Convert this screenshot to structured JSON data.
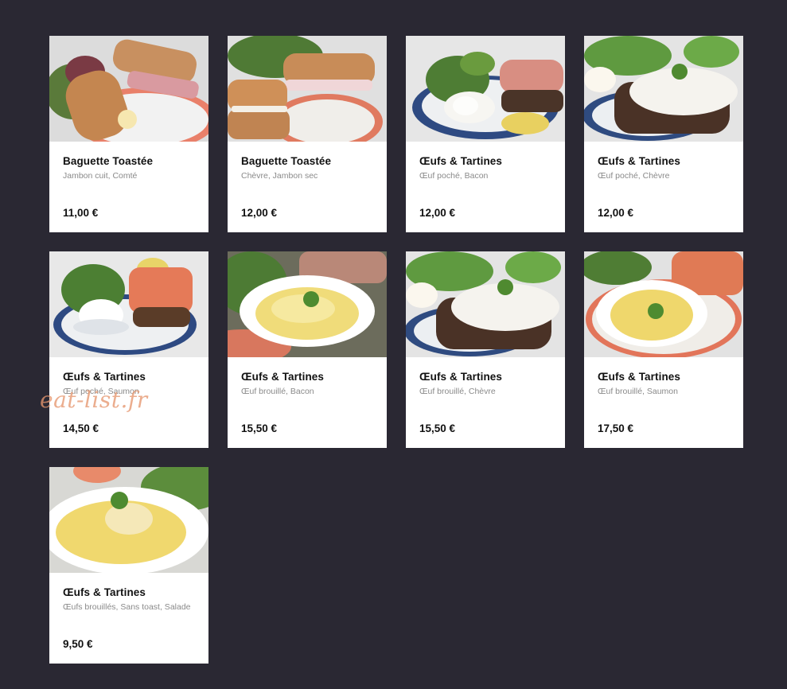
{
  "menu": {
    "items": [
      {
        "title": "Baguette Toastée",
        "description": "Jambon cuit, Comté",
        "price": "11,00 €",
        "photo": "baguette-ham"
      },
      {
        "title": "Baguette Toastée",
        "description": "Chèvre, Jambon sec",
        "price": "12,00 €",
        "photo": "baguette-ham"
      },
      {
        "title": "Œufs & Tartines",
        "description": "Œuf poché, Bacon",
        "price": "12,00 €",
        "photo": "poached-egg-plate"
      },
      {
        "title": "Œufs & Tartines",
        "description": "Œuf poché, Chèvre",
        "price": "12,00 €",
        "photo": "goat-cheese-toast"
      },
      {
        "title": "Œufs & Tartines",
        "description": "Œuf poché, Saumon",
        "price": "14,50 €",
        "photo": "poached-egg-plate"
      },
      {
        "title": "Œufs & Tartines",
        "description": "Œuf brouillé, Bacon",
        "price": "15,50 €",
        "photo": "scrambled-egg-dish"
      },
      {
        "title": "Œufs & Tartines",
        "description": "Œuf brouillé, Chèvre",
        "price": "15,50 €",
        "photo": "goat-cheese-toast"
      },
      {
        "title": "Œufs & Tartines",
        "description": "Œuf brouillé, Saumon",
        "price": "17,50 €",
        "photo": "scrambled-egg-dish"
      },
      {
        "title": "Œufs & Tartines",
        "description": "Œufs brouillés, Sans toast, Salade",
        "price": "9,50 €",
        "photo": "scrambled-egg-dish"
      }
    ]
  },
  "watermark": {
    "text": "eat-list.fr"
  },
  "colors": {
    "background": "#2a2833",
    "card": "#ffffff",
    "title_text": "#111111",
    "description_text": "#8a8a8a",
    "watermark": "#e6966e"
  }
}
